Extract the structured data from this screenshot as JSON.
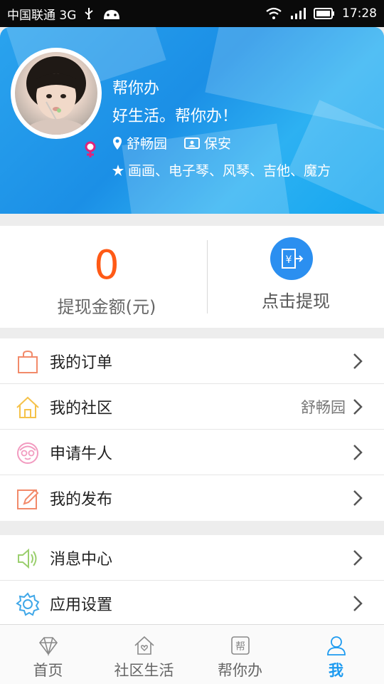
{
  "status_bar": {
    "carrier": "中国联通 3G",
    "time": "17:28"
  },
  "profile": {
    "name": "帮你办",
    "slogan": "好生活。帮你办！",
    "community": "舒畅园",
    "job": "保安",
    "hobbies": "画画、电子琴、风琴、吉他、魔方"
  },
  "withdraw": {
    "amount": "0",
    "amount_label": "提现金额(元)",
    "action_label": "点击提现"
  },
  "menu_group_1": [
    {
      "label": "我的订单",
      "value": "",
      "icon": "shopping-bag-icon"
    },
    {
      "label": "我的社区",
      "value": "舒畅园",
      "icon": "house-icon"
    },
    {
      "label": "申请牛人",
      "value": "",
      "icon": "avatar-glasses-icon"
    },
    {
      "label": "我的发布",
      "value": "",
      "icon": "edit-icon"
    }
  ],
  "menu_group_2": [
    {
      "label": "消息中心",
      "value": "",
      "icon": "speaker-icon"
    },
    {
      "label": "应用设置",
      "value": "",
      "icon": "gear-icon"
    }
  ],
  "tabs": [
    {
      "label": "首页",
      "icon": "diamond-icon"
    },
    {
      "label": "社区生活",
      "icon": "house-heart-icon"
    },
    {
      "label": "帮你办",
      "icon": "bang-stamp-icon"
    },
    {
      "label": "我",
      "icon": "user-icon"
    }
  ],
  "colors": {
    "accent": "#1e9bf0",
    "amount": "#ff5a16"
  }
}
